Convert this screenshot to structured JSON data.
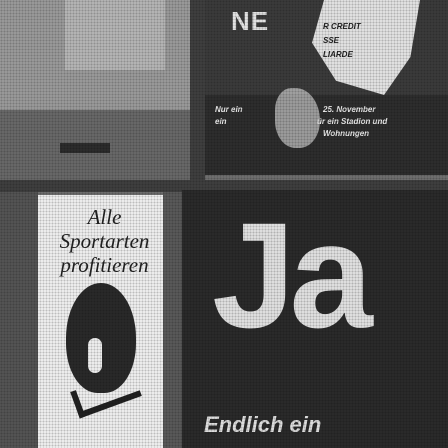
{
  "top_poster": {
    "headline_fragment": "NE",
    "badge_line1": "R CREDIT",
    "badge_line2": "SSE",
    "badge_line3": "LIARDE",
    "left_fragment_1": "Nur ein",
    "left_fragment_2": "ein",
    "right_line1": "25. November",
    "right_line2": "ür ein Stadion und",
    "right_line3": "Wohnungen"
  },
  "left_poster": {
    "headline_line1": "Alle Sportarten",
    "headline_line2": "profitieren"
  },
  "right_poster": {
    "big_word": "Ja",
    "subline": "Endlich ein"
  }
}
